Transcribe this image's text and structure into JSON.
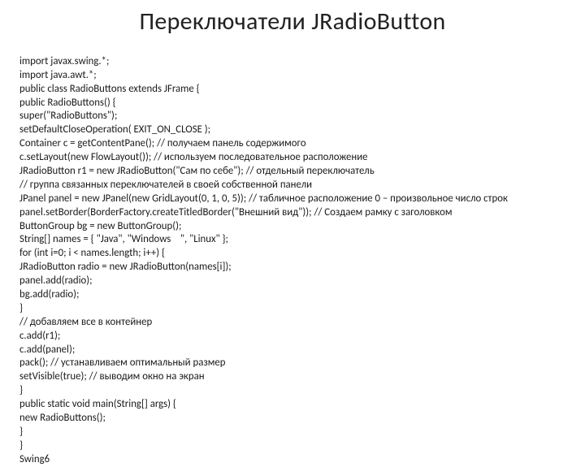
{
  "title": "Переключатели JRadioButton",
  "code": {
    "l1": "import javax.swing.*;",
    "l2": "import java.awt.*;",
    "l3": "public class RadioButtons extends JFrame {",
    "l4": "public RadioButtons() {",
    "l5": "super(\"RadioButtons\");",
    "l6": "setDefaultCloseOperation( EXIT_ON_CLOSE );",
    "l7": "Container c = getContentPane(); // получаем панель содержимого",
    "l8": "c.setLayout(new FlowLayout()); // используем последовательное расположение",
    "l9": "JRadioButton r1 = new JRadioButton(\"Сам по себе\"); // отдельный переключатель",
    "l10": "// группа связанных переключателей в своей собственной панели",
    "l11": "JPanel panel = new JPanel(new GridLayout(0, 1, 0, 5)); // табличное расположение 0 – произвольное число строк",
    "l12": "panel.setBorder(BorderFactory.createTitledBorder(\"Внешний вид\")); // Создаем рамку с заголовком",
    "l13": "ButtonGroup bg = new ButtonGroup();",
    "l14": "String[] names = { \"Java\", \"Windows    \", \"Linux\" };",
    "l15": "for (int i=0; i < names.length; i++) {",
    "l16": "JRadioButton radio = new JRadioButton(names[i]);",
    "l17": "panel.add(radio);",
    "l18": "bg.add(radio);",
    "l19": "}",
    "l20": "// добавляем все в контейнер",
    "l21": "c.add(r1);",
    "l22": "c.add(panel);",
    "l23": "pack(); // устанавливаем оптимальный размер",
    "l24": "setVisible(true); // выводим окно на экран",
    "l25": "}",
    "l26": "public static void main(String[] args) {",
    "l27": "new RadioButtons();",
    "l28": "}",
    "l29": "}",
    "l30": "Swing6"
  }
}
